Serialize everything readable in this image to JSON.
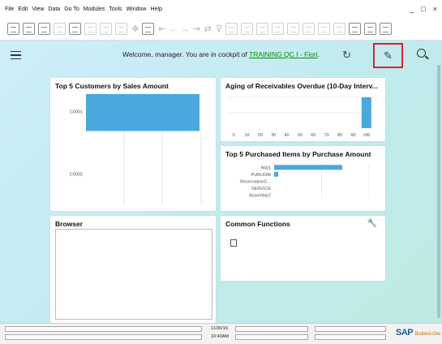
{
  "menu": {
    "items": [
      "File",
      "Edit",
      "View",
      "Data",
      "Go To",
      "Modules",
      "Tools",
      "Window",
      "Help"
    ],
    "min": "_",
    "max": "□",
    "close": "×"
  },
  "shell": {
    "welcome_prefix": "Welcome, manager. You are in cockpit of ",
    "cockpit_link": "TRAINING QC I - Fiori",
    "welcome_suffix": "."
  },
  "cards": {
    "customers": {
      "title": "Top 5 Customers by Sales Amount"
    },
    "aging": {
      "title": "Aging of Receivables Overdue (10-Day Interv..."
    },
    "items": {
      "title": "Top 5 Purchased Items by Purchase Amount"
    },
    "browser": {
      "title": "Browser"
    },
    "functions": {
      "title": "Common Functions"
    }
  },
  "status": {
    "date": "11/30/16",
    "time": "10:40AM",
    "brand": "SAP",
    "brand_sub": "Business One"
  },
  "colors": {
    "bar": "#4aa8dd",
    "highlight": "#d9232e",
    "link": "#0b8a00"
  },
  "chart_data": [
    {
      "type": "bar",
      "title": "Top 5 Customers by Sales Amount",
      "orientation": "horizontal",
      "categories": [
        "C0001",
        "C0002"
      ],
      "values": [
        100,
        0
      ],
      "grid": true
    },
    {
      "type": "bar",
      "title": "Aging of Receivables Overdue (10-Day Interv...",
      "categories": [
        "0",
        "10",
        "20",
        "30",
        "40",
        "50",
        "60",
        "70",
        "80",
        "90",
        ">90"
      ],
      "values": [
        0,
        0,
        0,
        0,
        0,
        0,
        0,
        0,
        0,
        0,
        100
      ],
      "grid": true
    },
    {
      "type": "bar",
      "title": "Top 5 Purchased Items by Purchase Amount",
      "orientation": "horizontal",
      "categories": [
        "Mat1",
        "PURUOM",
        "ReservationC...",
        "SERVICE",
        "Assembly2"
      ],
      "values": [
        100,
        6,
        0,
        0,
        0
      ],
      "grid": true
    }
  ]
}
